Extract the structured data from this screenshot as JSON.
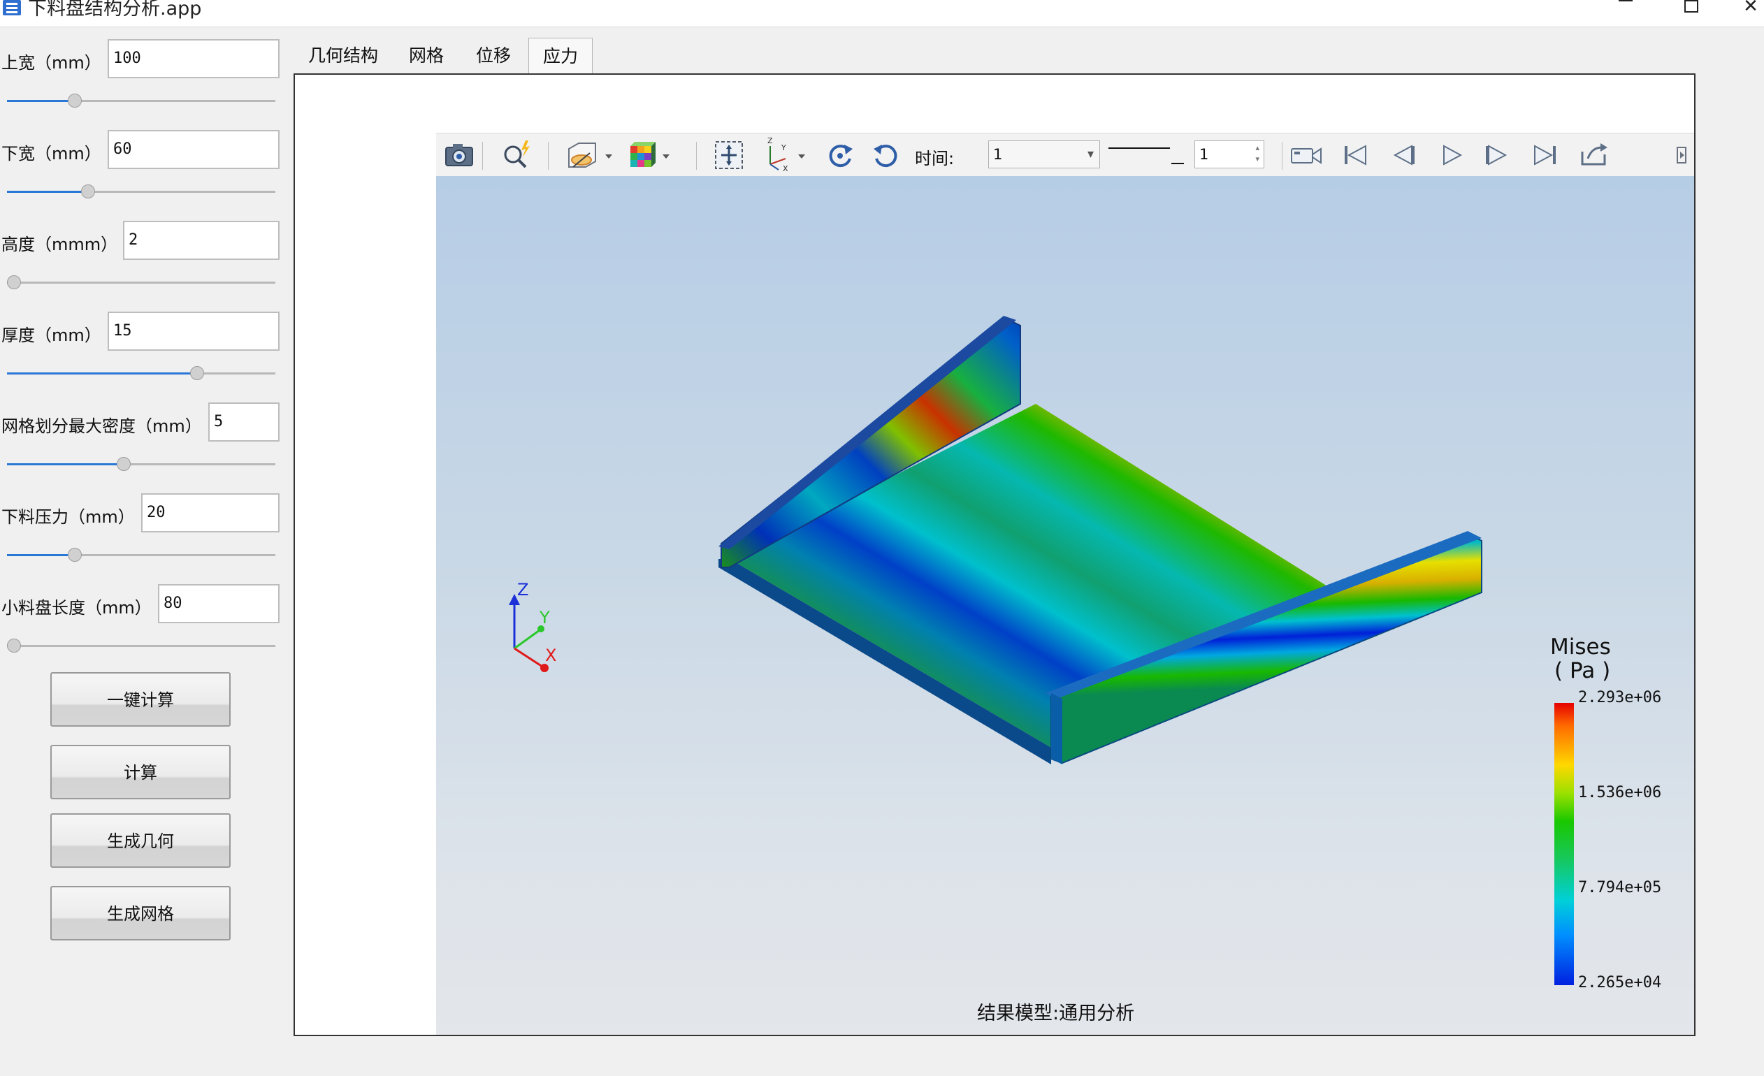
{
  "window": {
    "title": "下料盘结构分析.app"
  },
  "params": [
    {
      "label": "上宽（mm）",
      "value": "100",
      "fraction": 0.24
    },
    {
      "label": "下宽（mm）",
      "value": "60",
      "fraction": 0.29
    },
    {
      "label": "高度（mmm）",
      "value": "2",
      "fraction": 0.0
    },
    {
      "label": "厚度（mm）",
      "value": "15",
      "fraction": 0.72
    },
    {
      "label": "网格划分最大密度（mm）",
      "value": "5",
      "fraction": 0.43
    },
    {
      "label": "下料压力（mm）",
      "value": "20",
      "fraction": 0.24
    },
    {
      "label": "小料盘长度（mm）",
      "value": "80",
      "fraction": 0.0
    }
  ],
  "buttons": {
    "one_click": "一键计算",
    "compute": "计算",
    "gen_geometry": "生成几何",
    "gen_mesh": "生成网格"
  },
  "tabs": [
    {
      "label": "几何结构",
      "active": false
    },
    {
      "label": "网格",
      "active": false
    },
    {
      "label": "位移",
      "active": false
    },
    {
      "label": "应力",
      "active": true
    }
  ],
  "toolbar": {
    "icons": [
      "camera-icon",
      "zoom-icon",
      "section-view-icon",
      "display-mode-icon",
      "fit-view-icon",
      "axes-icon",
      "rotate-icon",
      "reset-rotate-icon",
      "record-icon",
      "first-frame-icon",
      "prev-frame-icon",
      "play-icon",
      "next-frame-icon",
      "last-frame-icon",
      "export-icon"
    ],
    "time_label": "时间:",
    "time_value": "1",
    "step_value": "1"
  },
  "legend": {
    "title": "Mises",
    "unit": "( Pa )",
    "ticks": [
      "2.293e+06",
      "1.536e+06",
      "7.794e+05",
      "2.265e+04"
    ],
    "colors": {
      "max": "#e50000",
      "mid": "#19c800",
      "min": "#0020e0"
    }
  },
  "axes": {
    "x": "X",
    "y": "Y",
    "z": "Z"
  },
  "status": "结果模型:通用分析"
}
